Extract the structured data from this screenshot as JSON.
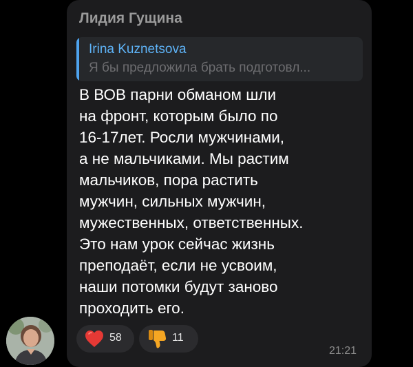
{
  "message": {
    "sender": "Лидия Гущина",
    "reply": {
      "author": "Irina Kuznetsova",
      "preview": "Я бы предложила брать подготовл..."
    },
    "text": "В ВОВ парни обманом шли\nна фронт, которым было по\n16-17лет. Росли мужчинами,\nа не мальчиками. Мы растим\nмальчиков, пора растить\nмужчин, сильных мужчин,\nмужественных, ответственных.\nЭто нам урок сейчас жизнь\nпреподаёт, если не усвоим,\nнаши потомки будут заново\nпроходить его.",
    "reactions": [
      {
        "icon": "heart-icon",
        "count": "58"
      },
      {
        "icon": "thumbs-down-icon",
        "count": "11"
      }
    ],
    "time": "21:21"
  },
  "colors": {
    "background": "#000000",
    "bubble": "#1c1c1e",
    "reply_accent": "#4ea3ee",
    "reply_name": "#5eb3f7",
    "text": "#ffffff",
    "heart": "#e53935",
    "thumb": "#f5a623"
  }
}
